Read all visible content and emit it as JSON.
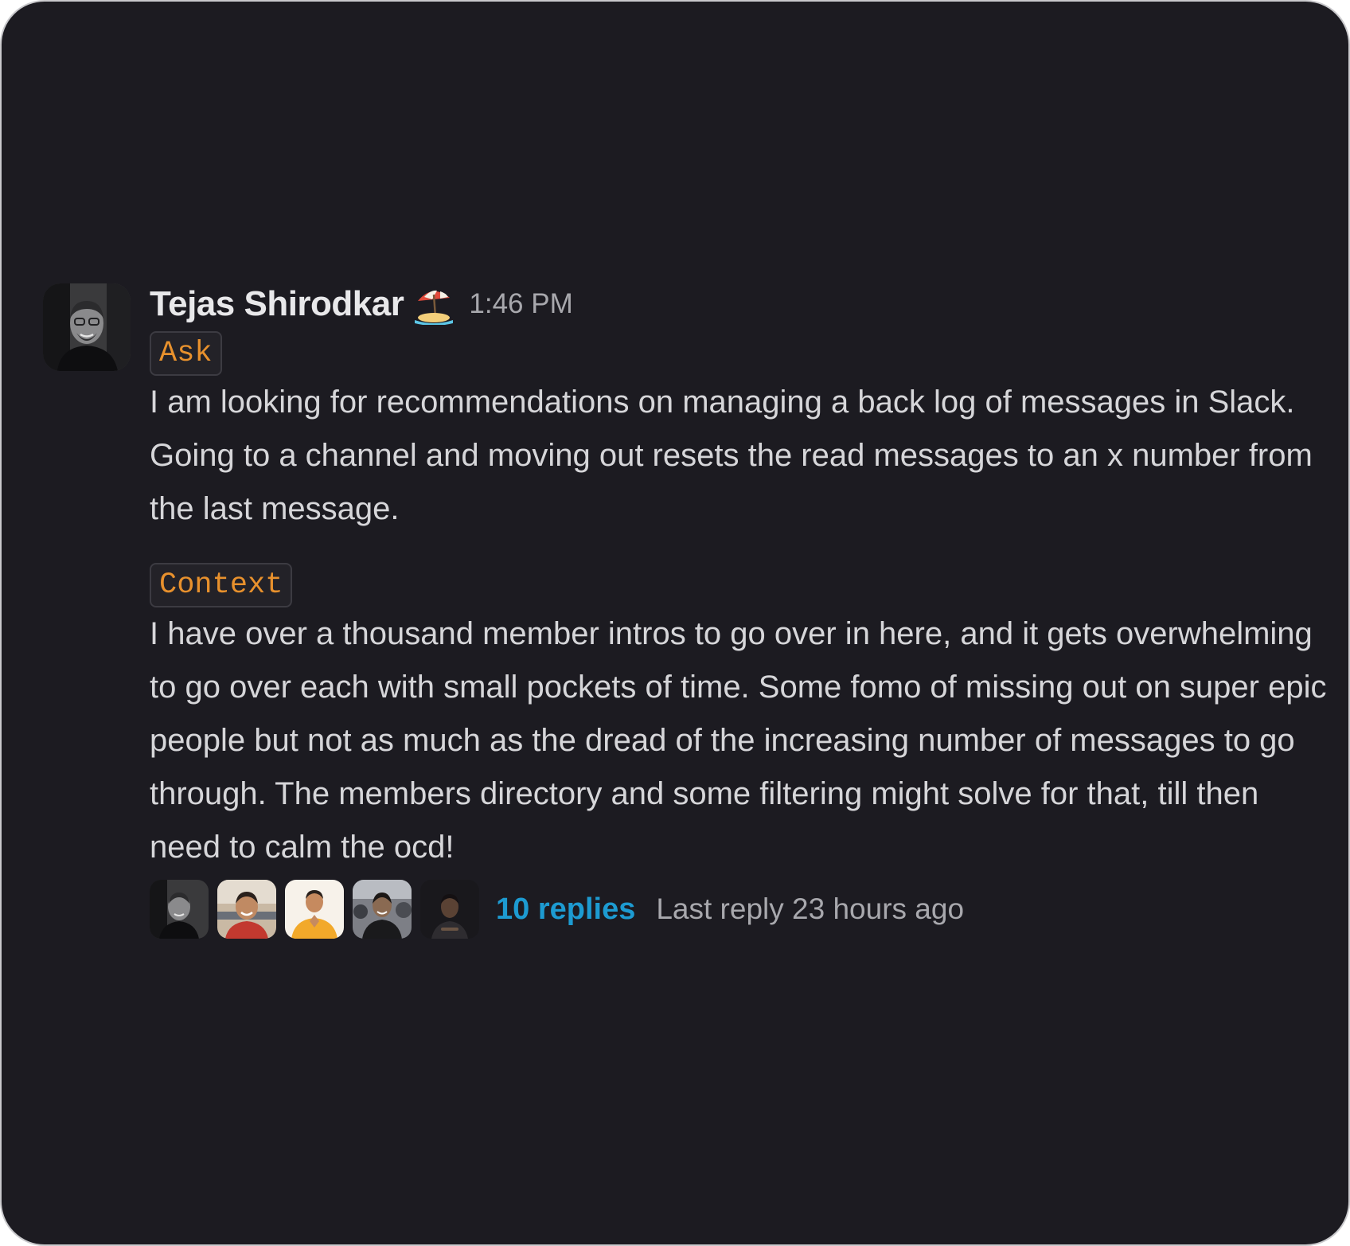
{
  "message": {
    "author": "Tejas Shirodkar",
    "status_icon": "beach-umbrella-icon",
    "timestamp": "1:46 PM",
    "sections": [
      {
        "tag": "Ask",
        "text": "I am looking for recommendations on managing a back log of messages in Slack. Going to a channel and moving out resets the read messages to an x number from the last message."
      },
      {
        "tag": "Context",
        "text": "I have over a thousand member intros to go over in here, and it gets overwhelming to go over each with small pockets of time. Some fomo of missing out on super epic people but not as much as the dread of the increasing number of messages to go through. The members directory and some filtering might solve for that, till then need to calm the ocd!"
      }
    ],
    "thread": {
      "replies_label": "10 replies",
      "last_reply": "Last reply 23 hours ago",
      "participant_avatars": [
        "avatar-1",
        "avatar-2",
        "avatar-3",
        "avatar-4",
        "avatar-5"
      ]
    }
  },
  "colors": {
    "background": "#1c1b21",
    "text": "#d6d6d9",
    "author": "#e8e8ea",
    "muted": "#a8a8ad",
    "tag": "#e8912d",
    "link": "#1d9bd1"
  }
}
